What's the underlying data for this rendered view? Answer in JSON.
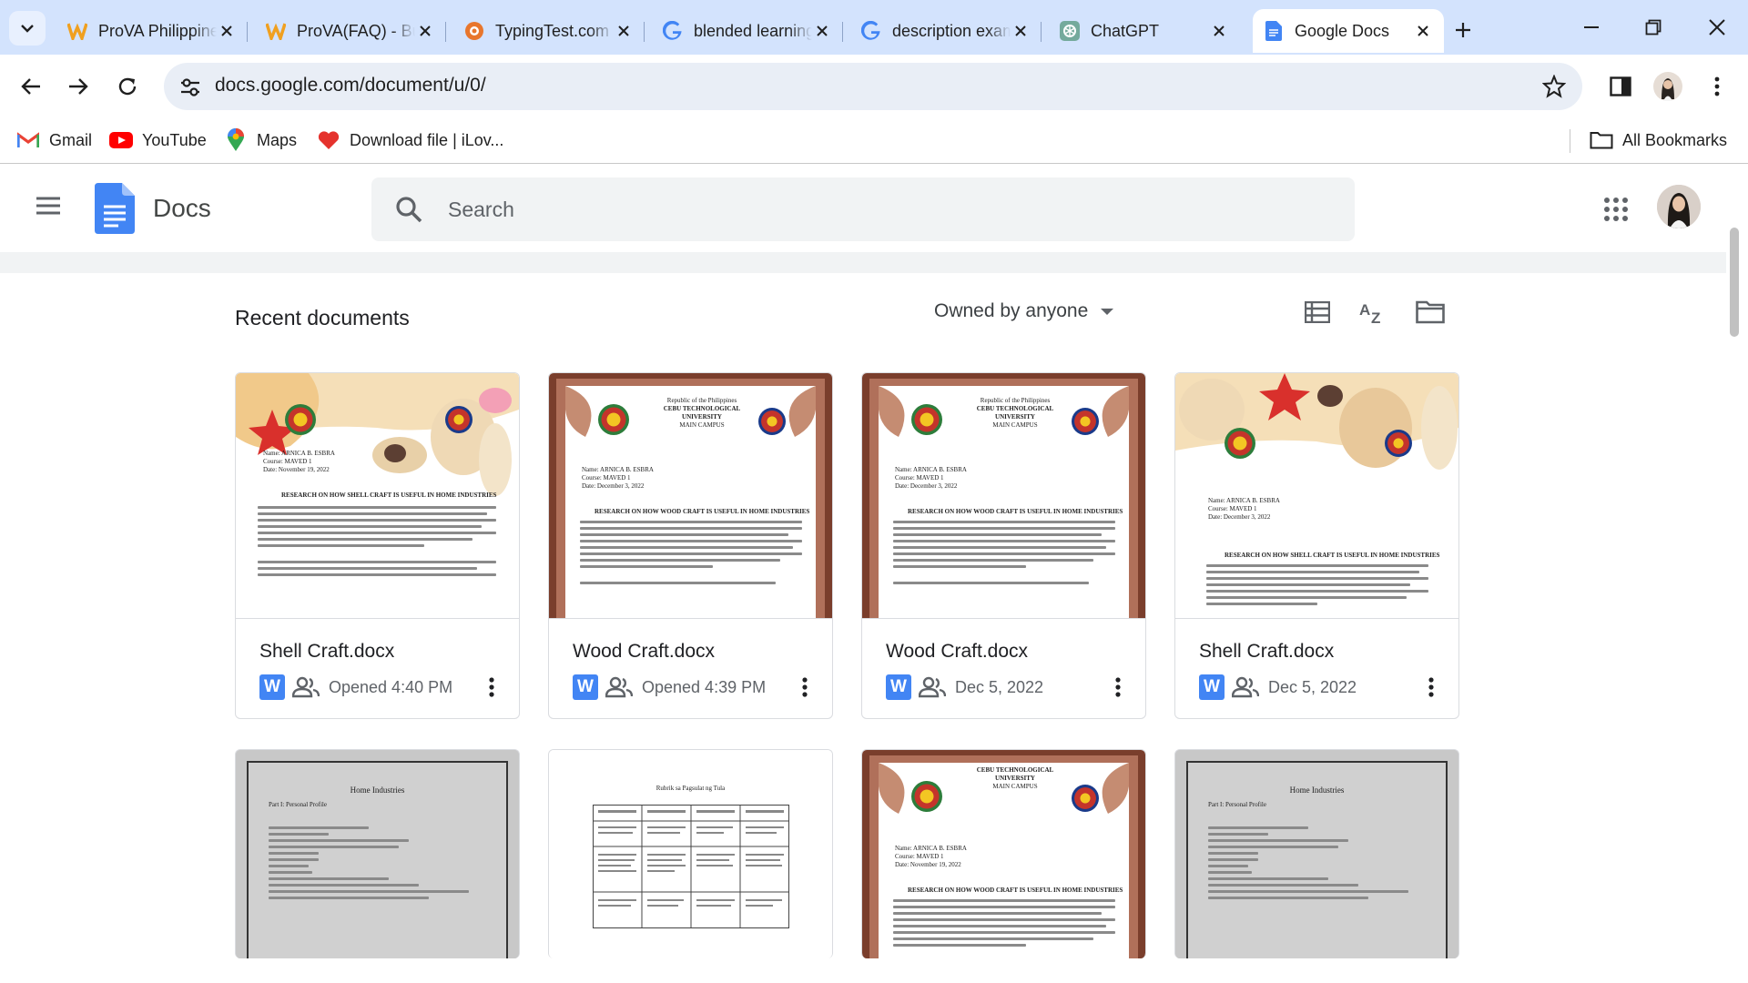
{
  "tabs": [
    {
      "title": "ProVA Philippines",
      "favicon": "prova-icon",
      "active": false
    },
    {
      "title": "ProVA(FAQ) - Bulletin",
      "favicon": "prova-icon",
      "active": false
    },
    {
      "title": "TypingTest.com",
      "favicon": "typingtest-icon",
      "active": false
    },
    {
      "title": "blended learning",
      "favicon": "google-icon",
      "active": false
    },
    {
      "title": "description example",
      "favicon": "google-icon",
      "active": false
    },
    {
      "title": "ChatGPT",
      "favicon": "chatgpt-icon",
      "active": false
    },
    {
      "title": "Google Docs",
      "favicon": "docs-icon",
      "active": true
    }
  ],
  "address_bar": {
    "url": "docs.google.com/document/u/0/"
  },
  "bookmarks": [
    {
      "label": "Gmail",
      "icon": "gmail-icon"
    },
    {
      "label": "YouTube",
      "icon": "youtube-icon"
    },
    {
      "label": "Maps",
      "icon": "maps-icon"
    },
    {
      "label": "Download file | iLov...",
      "icon": "ilovepdf-icon"
    }
  ],
  "all_bookmarks_label": "All Bookmarks",
  "app": {
    "name": "Docs",
    "search_placeholder": "Search"
  },
  "section": {
    "title": "Recent documents",
    "owner_filter": "Owned by anyone"
  },
  "documents": [
    {
      "name": "Shell Craft.docx",
      "meta": "Opened 4:40 PM",
      "thumb": "shell"
    },
    {
      "name": "Wood Craft.docx",
      "meta": "Opened 4:39 PM",
      "thumb": "wood"
    },
    {
      "name": "Wood Craft.docx",
      "meta": "Dec 5, 2022",
      "thumb": "wood"
    },
    {
      "name": "Shell Craft.docx",
      "meta": "Dec 5, 2022",
      "thumb": "shell"
    },
    {
      "name": "",
      "meta": "",
      "thumb": "profile"
    },
    {
      "name": "",
      "meta": "",
      "thumb": "table"
    },
    {
      "name": "",
      "meta": "",
      "thumb": "wood"
    },
    {
      "name": "",
      "meta": "",
      "thumb": "profile"
    }
  ],
  "thumb_text": {
    "republic": "Republic of the Philippines",
    "university": "CEBU TECHNOLOGICAL UNIVERSITY",
    "campus": "MAIN CAMPUS",
    "name_label": "Name: ARNICA B. ESBRA",
    "course_label": "Course: MAVED 1",
    "date_nov": "Date: November 19, 2022",
    "date_dec": "Date: December 3, 2022",
    "shell_heading": "RESEARCH ON HOW SHELL CRAFT IS USEFUL IN HOME INDUSTRIES",
    "wood_heading": "RESEARCH ON HOW WOOD CRAFT IS USEFUL IN HOME INDUSTRIES",
    "home_industries": "Home Industries",
    "part1": "Part I: Personal Profile",
    "table_title": "Rubrik sa Pagsulat ng Tula"
  },
  "colors": {
    "tab_strip": "#d3e3fd",
    "omnibox": "#e9eef6",
    "docs_blue": "#4285f4",
    "search_bg": "#f1f3f4",
    "wood_frame": "#7a3e2c"
  }
}
